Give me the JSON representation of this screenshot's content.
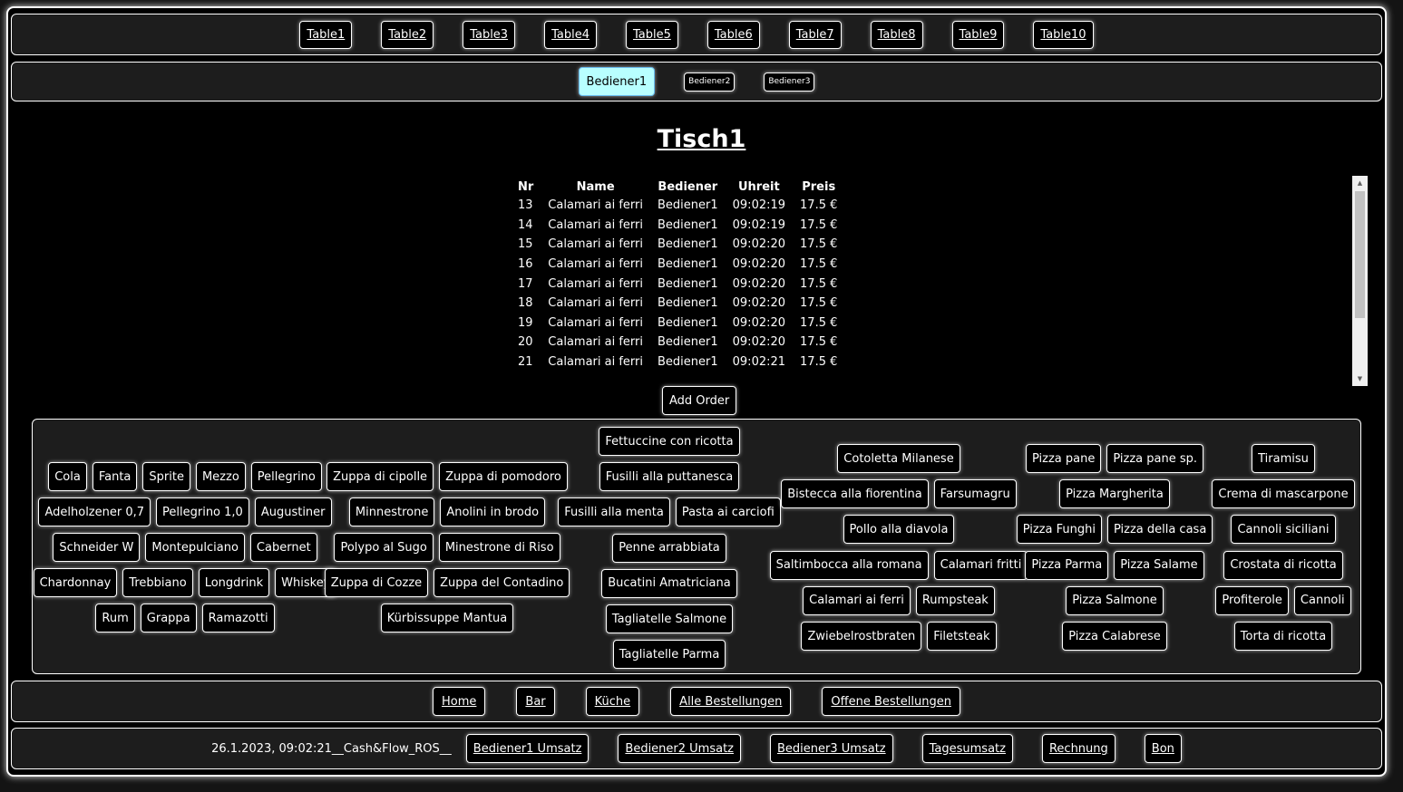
{
  "tables": [
    "Table1",
    "Table2",
    "Table3",
    "Table4",
    "Table5",
    "Table6",
    "Table7",
    "Table8",
    "Table9",
    "Table10"
  ],
  "waiters": {
    "active": "Bediener1",
    "others": [
      "Bediener2",
      "Bediener3"
    ]
  },
  "table_title": "Tisch1",
  "orders": {
    "headers": [
      "Nr",
      "Name",
      "Bediener",
      "Uhreit",
      "Preis"
    ],
    "rows": [
      [
        "13",
        "Calamari ai ferri",
        "Bediener1",
        "09:02:19",
        "17.5 €"
      ],
      [
        "14",
        "Calamari ai ferri",
        "Bediener1",
        "09:02:19",
        "17.5 €"
      ],
      [
        "15",
        "Calamari ai ferri",
        "Bediener1",
        "09:02:20",
        "17.5 €"
      ],
      [
        "16",
        "Calamari ai ferri",
        "Bediener1",
        "09:02:20",
        "17.5 €"
      ],
      [
        "17",
        "Calamari ai ferri",
        "Bediener1",
        "09:02:20",
        "17.5 €"
      ],
      [
        "18",
        "Calamari ai ferri",
        "Bediener1",
        "09:02:20",
        "17.5 €"
      ],
      [
        "19",
        "Calamari ai ferri",
        "Bediener1",
        "09:02:20",
        "17.5 €"
      ],
      [
        "20",
        "Calamari ai ferri",
        "Bediener1",
        "09:02:20",
        "17.5 €"
      ],
      [
        "21",
        "Calamari ai ferri",
        "Bediener1",
        "09:02:21",
        "17.5 €"
      ]
    ]
  },
  "add_order_label": "Add Order",
  "menu": {
    "drinks": [
      [
        "Cola",
        "Fanta",
        "Sprite",
        "Mezzo",
        "Pellegrino"
      ],
      [
        "Adelholzener 0,7",
        "Pellegrino 1,0",
        "Augustiner"
      ],
      [
        "Schneider W",
        "Montepulciano",
        "Cabernet"
      ],
      [
        "Chardonnay",
        "Trebbiano",
        "Longdrink",
        "Whiskey"
      ],
      [
        "Rum",
        "Grappa",
        "Ramazotti"
      ]
    ],
    "soups": [
      [
        "Zuppa di cipolle",
        "Zuppa di pomodoro"
      ],
      [
        "Minnestrone",
        "Anolini in brodo"
      ],
      [
        "Polypo al Sugo",
        "Minestrone di Riso"
      ],
      [
        "Zuppa di Cozze",
        "Zuppa del Contadino"
      ],
      [
        "Kürbissuppe Mantua"
      ]
    ],
    "pasta": [
      [
        "Fettuccine con ricotta"
      ],
      [
        "Fusilli alla puttanesca"
      ],
      [
        "Fusilli alla menta",
        "Pasta ai carciofi"
      ],
      [
        "Penne arrabbiata"
      ],
      [
        "Bucatini Amatriciana"
      ],
      [
        "Tagliatelle Salmone"
      ],
      [
        "Tagliatelle Parma"
      ]
    ],
    "mains": [
      [
        "Cotoletta Milanese"
      ],
      [
        "Bistecca alla fiorentina",
        "Farsumagru"
      ],
      [
        "Pollo alla diavola"
      ],
      [
        "Saltimbocca alla romana",
        "Calamari fritti"
      ],
      [
        "Calamari ai ferri",
        "Rumpsteak"
      ],
      [
        "Zwiebelrostbraten",
        "Filetsteak"
      ]
    ],
    "pizza": [
      [
        "Pizza pane",
        "Pizza pane sp."
      ],
      [
        "Pizza Margherita"
      ],
      [
        "Pizza Funghi",
        "Pizza della casa"
      ],
      [
        "Pizza Parma",
        "Pizza Salame"
      ],
      [
        "Pizza Salmone"
      ],
      [
        "Pizza Calabrese"
      ]
    ],
    "desserts": [
      [
        "Tiramisu"
      ],
      [
        "Crema di mascarpone"
      ],
      [
        "Cannoli siciliani"
      ],
      [
        "Crostata di ricotta"
      ],
      [
        "Profiterole",
        "Cannoli"
      ],
      [
        "Torta di ricotta"
      ]
    ]
  },
  "nav": [
    "Home",
    "Bar",
    "Küche",
    "Alle Bestellungen",
    "Offene Bestellungen"
  ],
  "footer": {
    "status": "26.1.2023, 09:02:21__Cash&Flow_ROS__",
    "buttons": [
      "Bediener1 Umsatz",
      "Bediener2 Umsatz",
      "Bediener3 Umsatz",
      "Tagesumsatz",
      "Rechnung",
      "Bon"
    ]
  }
}
